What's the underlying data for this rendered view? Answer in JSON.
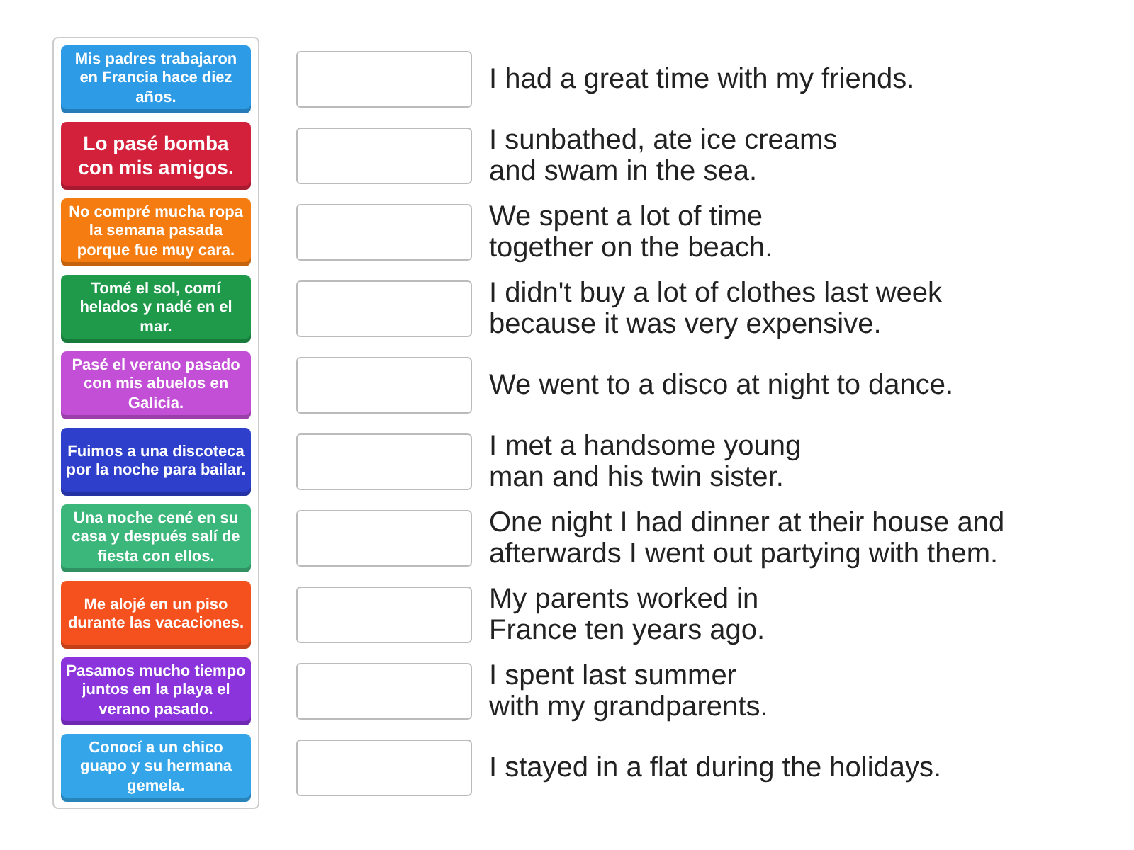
{
  "cards": [
    {
      "text": "Mis padres trabajaron en Francia hace diez años.",
      "color": "#2d9be6"
    },
    {
      "text": "Lo pasé bomba con mis amigos.",
      "color": "#d3213c"
    },
    {
      "text": "No compré mucha ropa la semana pasada porque fue muy cara.",
      "color": "#f57c10"
    },
    {
      "text": "Tomé el sol, comí helados y nadé en el mar.",
      "color": "#1f9a4b"
    },
    {
      "text": "Pasé el verano pasado con mis abuelos en Galicia.",
      "color": "#c24fd6"
    },
    {
      "text": "Fuimos a una discoteca por la noche para bailar.",
      "color": "#2e3fcc"
    },
    {
      "text": "Una noche cené en su casa y después salí de fiesta con ellos.",
      "color": "#3cb77c"
    },
    {
      "text": "Me alojé en un piso durante las vacaciones.",
      "color": "#f4511e"
    },
    {
      "text": "Pasamos mucho tiempo juntos en la playa el verano pasado.",
      "color": "#8b34dc"
    },
    {
      "text": "Conocí a un chico guapo y su hermana gemela.",
      "color": "#34a5e8"
    }
  ],
  "targets": [
    {
      "text": "I had a great time with my friends."
    },
    {
      "text": "I sunbathed, ate ice creams\nand swam in the sea."
    },
    {
      "text": "We spent a lot of time\ntogether on the beach."
    },
    {
      "text": "I didn't buy a lot of clothes last week\nbecause it was very expensive."
    },
    {
      "text": "We went to a disco at night to dance."
    },
    {
      "text": "I met a handsome young\nman and his twin sister."
    },
    {
      "text": "One night I had dinner at their house and\nafterwards I went out partying with them."
    },
    {
      "text": "My parents worked in\nFrance ten years ago."
    },
    {
      "text": "I spent last summer\nwith my grandparents."
    },
    {
      "text": "I stayed in a flat during the holidays."
    }
  ]
}
